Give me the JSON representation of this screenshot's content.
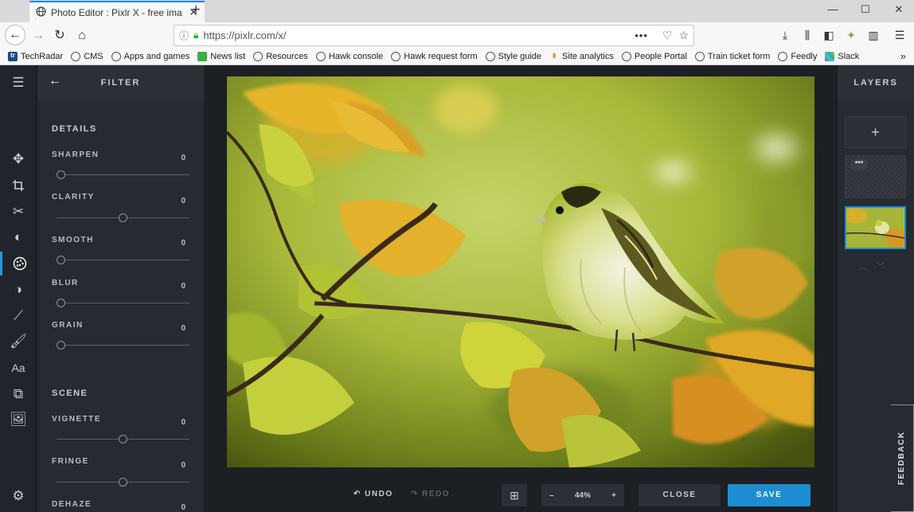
{
  "browser": {
    "tab_title": "Photo Editor : Pixlr X - free ima",
    "url": "https://pixlr.com/x/",
    "bookmarks": [
      "TechRadar",
      "CMS",
      "Apps and games",
      "News list",
      "Resources",
      "Hawk console",
      "Hawk request form",
      "Style guide",
      "Site analytics",
      "People Portal",
      "Train ticket form",
      "Feedly",
      "Slack"
    ]
  },
  "filter_panel": {
    "title": "FILTER",
    "sections": [
      {
        "heading": "DETAILS",
        "sliders": [
          {
            "label": "SHARPEN",
            "value": "0",
            "level": 0
          },
          {
            "label": "CLARITY",
            "value": "0",
            "level": 0.5
          },
          {
            "label": "SMOOTH",
            "value": "0",
            "level": 0
          },
          {
            "label": "BLUR",
            "value": "0",
            "level": 0
          },
          {
            "label": "GRAIN",
            "value": "0",
            "level": 0
          }
        ]
      },
      {
        "heading": "SCENE",
        "sliders": [
          {
            "label": "VIGNETTE",
            "value": "0",
            "level": 0.5
          },
          {
            "label": "FRINGE",
            "value": "0",
            "level": 0.5
          },
          {
            "label": "DEHAZE",
            "value": "0",
            "level": 0.5
          }
        ]
      }
    ]
  },
  "layers_panel": {
    "title": "LAYERS",
    "add_label": "+",
    "layer_menu": "•••"
  },
  "bottom_bar": {
    "undo": "UNDO",
    "redo": "REDO",
    "zoom_minus": "–",
    "zoom": "44%",
    "zoom_plus": "+",
    "close": "CLOSE",
    "save": "SAVE"
  },
  "feedback": "FEEDBACK",
  "colors": {
    "accent": "#1d8ed1",
    "panel": "#262a31",
    "background": "#1c1f24"
  }
}
